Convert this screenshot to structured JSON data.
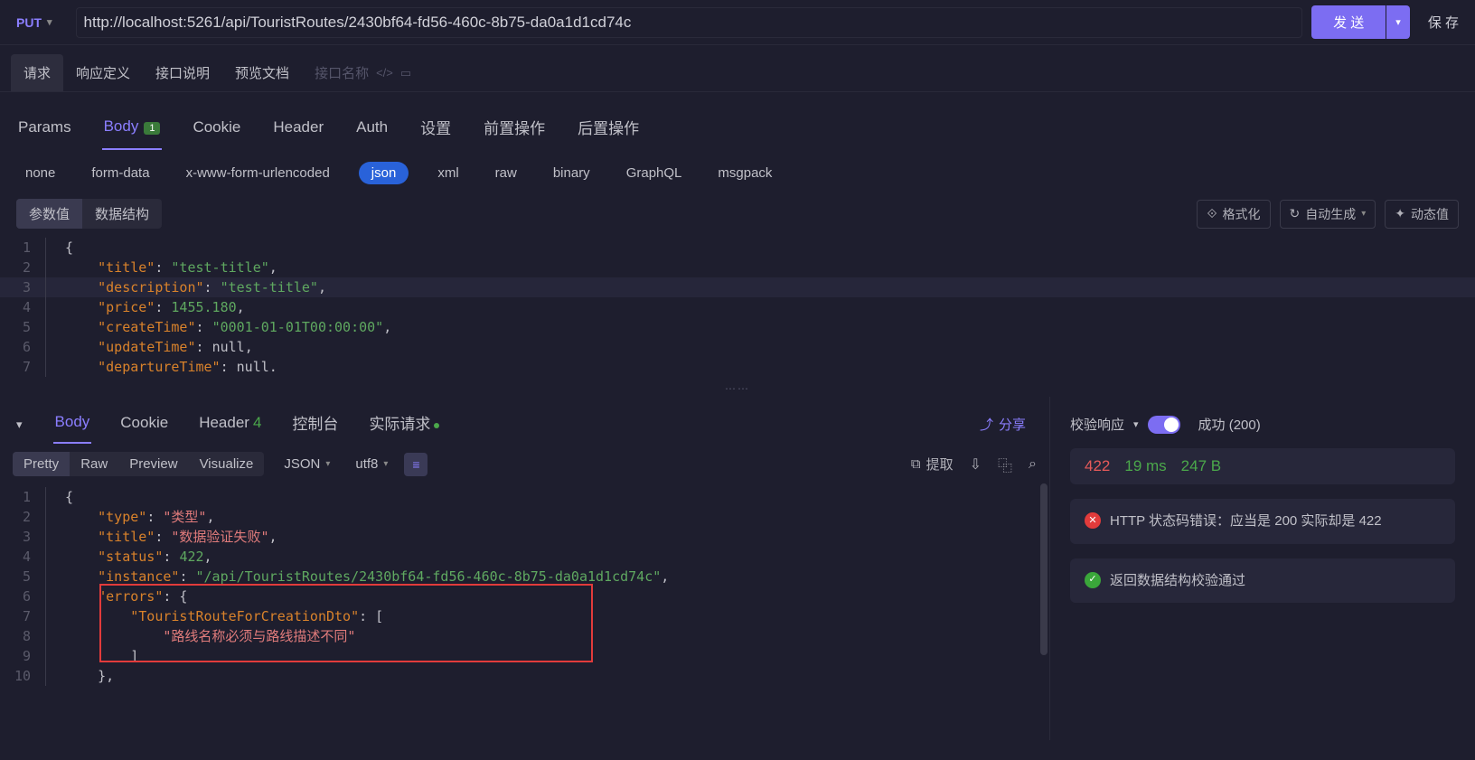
{
  "request": {
    "method": "PUT",
    "url": "http://localhost:5261/api/TouristRoutes/2430bf64-fd56-460c-8b75-da0a1d1cd74c",
    "sendLabel": "发 送",
    "saveLabel": "保 存"
  },
  "topTabs": {
    "items": [
      "请求",
      "响应定义",
      "接口说明",
      "预览文档"
    ],
    "activeIndex": 0,
    "placeholder": "接口名称"
  },
  "reqTabs": {
    "items": [
      {
        "label": "Params"
      },
      {
        "label": "Body",
        "badge": "1"
      },
      {
        "label": "Cookie"
      },
      {
        "label": "Header"
      },
      {
        "label": "Auth"
      },
      {
        "label": "设置"
      },
      {
        "label": "前置操作"
      },
      {
        "label": "后置操作"
      }
    ],
    "activeIndex": 1
  },
  "bodyTypes": {
    "items": [
      "none",
      "form-data",
      "x-www-form-urlencoded",
      "json",
      "xml",
      "raw",
      "binary",
      "GraphQL",
      "msgpack"
    ],
    "activeIndex": 3
  },
  "modeBtns": {
    "items": [
      "参数值",
      "数据结构"
    ],
    "activeIndex": 0,
    "formatLabel": "格式化",
    "autoGenLabel": "自动生成",
    "dynamicLabel": "动态值"
  },
  "reqBody": {
    "hlLine": 3,
    "lines": [
      {
        "n": 1,
        "tokens": [
          [
            "punc",
            "{"
          ]
        ]
      },
      {
        "n": 2,
        "tokens": [
          [
            "ind",
            "    "
          ],
          [
            "key",
            "\"title\""
          ],
          [
            "punc",
            ": "
          ],
          [
            "str",
            "\"test-title\""
          ],
          [
            "punc",
            ","
          ]
        ]
      },
      {
        "n": 3,
        "tokens": [
          [
            "ind",
            "    "
          ],
          [
            "key",
            "\"description\""
          ],
          [
            "punc",
            ": "
          ],
          [
            "str",
            "\"test-title\""
          ],
          [
            "punc",
            ","
          ]
        ]
      },
      {
        "n": 4,
        "tokens": [
          [
            "ind",
            "    "
          ],
          [
            "key",
            "\"price\""
          ],
          [
            "punc",
            ": "
          ],
          [
            "num",
            "1455.180"
          ],
          [
            "punc",
            ","
          ]
        ]
      },
      {
        "n": 5,
        "tokens": [
          [
            "ind",
            "    "
          ],
          [
            "key",
            "\"createTime\""
          ],
          [
            "punc",
            ": "
          ],
          [
            "str",
            "\"0001-01-01T00:00:00\""
          ],
          [
            "punc",
            ","
          ]
        ]
      },
      {
        "n": 6,
        "tokens": [
          [
            "ind",
            "    "
          ],
          [
            "key",
            "\"updateTime\""
          ],
          [
            "punc",
            ": "
          ],
          [
            "null",
            "null"
          ],
          [
            "punc",
            ","
          ]
        ]
      },
      {
        "n": 7,
        "tokens": [
          [
            "ind",
            "    "
          ],
          [
            "key",
            "\"departureTime\""
          ],
          [
            "punc",
            ": "
          ],
          [
            "null",
            "null"
          ],
          [
            "punc",
            "."
          ]
        ]
      }
    ]
  },
  "respTabs": {
    "collapse": "▾",
    "items": [
      {
        "label": "Body"
      },
      {
        "label": "Cookie"
      },
      {
        "label": "Header",
        "count": "4"
      },
      {
        "label": "控制台"
      },
      {
        "label": "实际请求",
        "dot": true
      }
    ],
    "activeIndex": 0,
    "shareLabel": "分享"
  },
  "respToolbar": {
    "views": [
      "Pretty",
      "Raw",
      "Preview",
      "Visualize"
    ],
    "activeView": 0,
    "format": "JSON",
    "encoding": "utf8",
    "extractLabel": "提取"
  },
  "respBody": {
    "lines": [
      {
        "n": 1,
        "tokens": [
          [
            "punc",
            "{"
          ]
        ]
      },
      {
        "n": 2,
        "tokens": [
          [
            "ind",
            "    "
          ],
          [
            "key",
            "\"type\""
          ],
          [
            "punc",
            ": "
          ],
          [
            "strcn",
            "\"类型\""
          ],
          [
            "punc",
            ","
          ]
        ]
      },
      {
        "n": 3,
        "tokens": [
          [
            "ind",
            "    "
          ],
          [
            "key",
            "\"title\""
          ],
          [
            "punc",
            ": "
          ],
          [
            "strcn",
            "\"数据验证失败\""
          ],
          [
            "punc",
            ","
          ]
        ]
      },
      {
        "n": 4,
        "tokens": [
          [
            "ind",
            "    "
          ],
          [
            "key",
            "\"status\""
          ],
          [
            "punc",
            ": "
          ],
          [
            "num",
            "422"
          ],
          [
            "punc",
            ","
          ]
        ]
      },
      {
        "n": 5,
        "tokens": [
          [
            "ind",
            "    "
          ],
          [
            "key",
            "\"instance\""
          ],
          [
            "punc",
            ": "
          ],
          [
            "str",
            "\"/api/TouristRoutes/2430bf64-fd56-460c-8b75-da0a1d1cd74c\""
          ],
          [
            "punc",
            ","
          ]
        ]
      },
      {
        "n": 6,
        "tokens": [
          [
            "ind",
            "    "
          ],
          [
            "key",
            "\"errors\""
          ],
          [
            "punc",
            ": {"
          ]
        ]
      },
      {
        "n": 7,
        "tokens": [
          [
            "ind",
            "        "
          ],
          [
            "key",
            "\"TouristRouteForCreationDto\""
          ],
          [
            "punc",
            ": ["
          ]
        ]
      },
      {
        "n": 8,
        "tokens": [
          [
            "ind",
            "            "
          ],
          [
            "strcn",
            "\"路线名称必须与路线描述不同\""
          ]
        ]
      },
      {
        "n": 9,
        "tokens": [
          [
            "ind",
            "        "
          ],
          [
            "punc",
            "]"
          ]
        ]
      },
      {
        "n": 10,
        "tokens": [
          [
            "ind",
            "    "
          ],
          [
            "punc",
            "}"
          ],
          [
            "punc",
            ","
          ]
        ]
      }
    ]
  },
  "validation": {
    "title": "校验响应",
    "successLabel": "成功 (200)",
    "statusCode": "422",
    "time": "19 ms",
    "size": "247 B",
    "errorMsg": "HTTP 状态码错误：应当是 200 实际却是 422",
    "okMsg": "返回数据结构校验通过"
  }
}
